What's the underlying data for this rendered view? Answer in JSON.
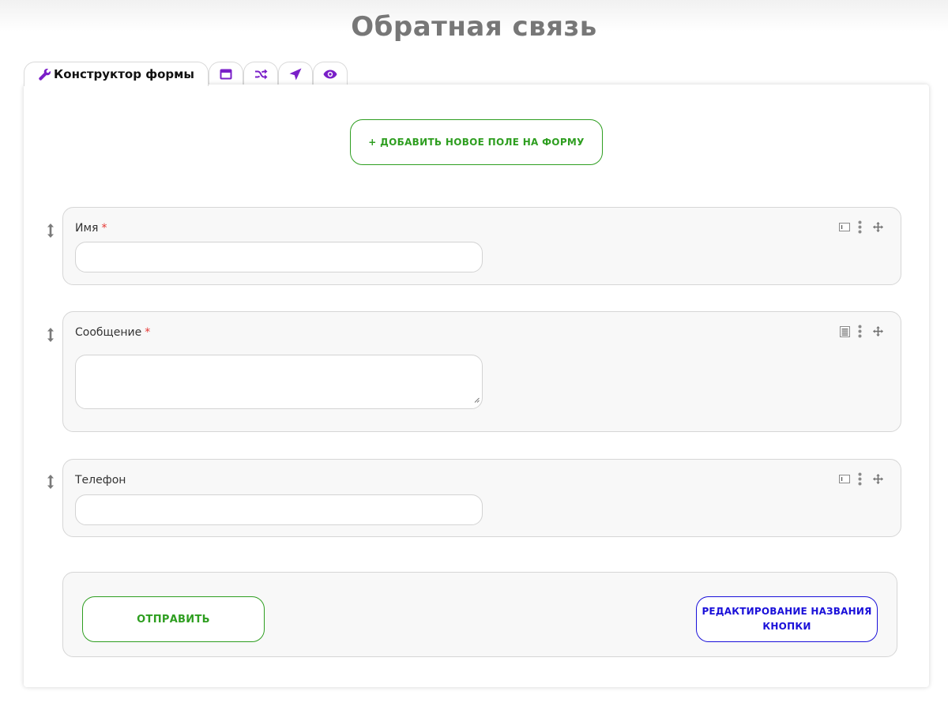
{
  "page": {
    "title": "Обратная связь"
  },
  "tabs": [
    {
      "label": "Конструктор формы",
      "icon": "wrench-icon",
      "active": true
    },
    {
      "label": "",
      "icon": "window-icon"
    },
    {
      "label": "",
      "icon": "shuffle-icon"
    },
    {
      "label": "",
      "icon": "location-arrow-icon"
    },
    {
      "label": "",
      "icon": "eye-icon"
    }
  ],
  "colors": {
    "accent_purple": "#7a1fc8",
    "green": "#2e9e20",
    "blue": "#1a10d9",
    "required": "#e53935"
  },
  "builder": {
    "add_field_label": "+ ДОБАВИТЬ НОВОЕ ПОЛЕ НА ФОРМУ",
    "fields": [
      {
        "label": "Имя",
        "required_mark": "*",
        "type": "input",
        "value": ""
      },
      {
        "label": "Сообщение",
        "required_mark": "*",
        "type": "textarea",
        "value": ""
      },
      {
        "label": "Телефон",
        "required_mark": "",
        "type": "input",
        "value": ""
      }
    ],
    "submit_label": "ОТПРАВИТЬ",
    "rename_button_label": "РЕДАКТИРОВАНИЕ НАЗВАНИЯ КНОПКИ"
  }
}
